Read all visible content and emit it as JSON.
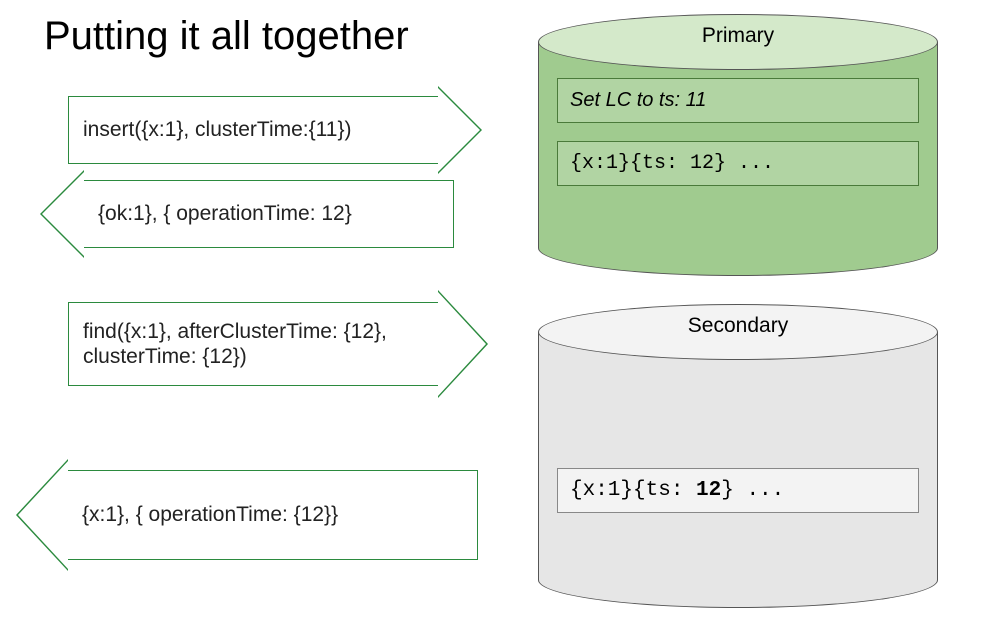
{
  "title": "Putting it all together",
  "arrows": {
    "a1": "insert({x:1}, clusterTime:{11})",
    "a2": "{ok:1}, { operationTime: 12}",
    "a3": "find({x:1}, afterClusterTime: {12}, clusterTime: {12})",
    "a4": "{x:1}, { operationTime: {12}}"
  },
  "primary": {
    "label": "Primary",
    "box1": "Set LC to ts: 11",
    "box2": "{x:1}{ts: 12} ..."
  },
  "secondary": {
    "label": "Secondary",
    "box_prefix": "{x:1}{ts: ",
    "box_bold": "12",
    "box_suffix": "} ..."
  }
}
